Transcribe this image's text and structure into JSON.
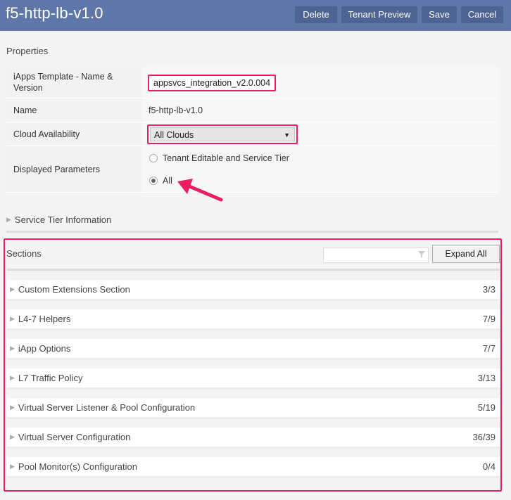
{
  "header": {
    "title": "f5-http-lb-v1.0",
    "buttons": {
      "delete": "Delete",
      "tenant_preview": "Tenant Preview",
      "save": "Save",
      "cancel": "Cancel"
    }
  },
  "properties": {
    "heading": "Properties",
    "template_label": "iApps Template - Name & Version",
    "template_value": "appsvcs_integration_v2.0.004",
    "name_label": "Name",
    "name_value": "f5-http-lb-v1.0",
    "cloud_label": "Cloud Availability",
    "cloud_value": "All Clouds",
    "params_label": "Displayed Parameters",
    "params_options": [
      "Tenant Editable and Service Tier",
      "All"
    ],
    "params_selected": "All"
  },
  "service_tier": {
    "label": "Service Tier Information"
  },
  "sections": {
    "title": "Sections",
    "filter_placeholder": "",
    "expand_all": "Expand All",
    "items": [
      {
        "name": "Custom Extensions Section",
        "count": "3/3"
      },
      {
        "name": "L4-7 Helpers",
        "count": "7/9"
      },
      {
        "name": "iApp Options",
        "count": "7/7"
      },
      {
        "name": "L7 Traffic Policy",
        "count": "3/13"
      },
      {
        "name": "Virtual Server Listener & Pool Configuration",
        "count": "5/19"
      },
      {
        "name": "Virtual Server Configuration",
        "count": "36/39"
      },
      {
        "name": "Pool Monitor(s) Configuration",
        "count": "0/4"
      }
    ]
  },
  "colors": {
    "header_bg": "#5f77a8",
    "button_bg": "#4c6394",
    "highlight": "#e91e63"
  }
}
